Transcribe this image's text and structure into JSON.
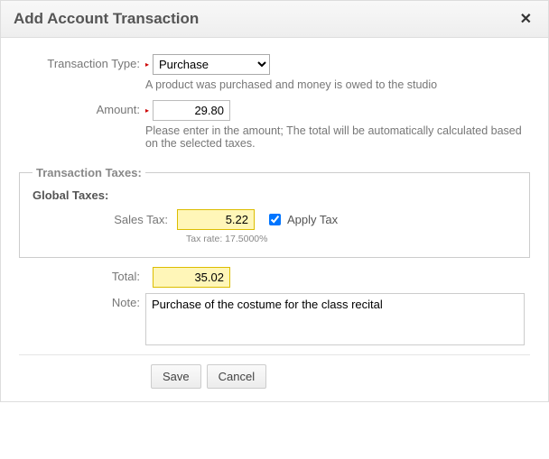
{
  "dialog": {
    "title": "Add Account Transaction"
  },
  "labels": {
    "transactionType": "Transaction Type:",
    "amount": "Amount:",
    "total": "Total:",
    "note": "Note:",
    "salesTax": "Sales Tax:",
    "applyTax": "Apply Tax",
    "globalTaxes": "Global Taxes:",
    "taxesLegend": "Transaction Taxes:"
  },
  "transaction": {
    "typeOptions": [
      "Purchase"
    ],
    "typeSelected": "Purchase",
    "typeHelp": "A product was purchased and money is owed to the studio",
    "amount": "29.80",
    "amountHelp": "Please enter in the amount; The total will be automatically calculated based on the selected taxes.",
    "total": "35.02",
    "note": "Purchase of the costume for the class recital"
  },
  "taxes": {
    "salesTaxAmount": "5.22",
    "applyTaxChecked": true,
    "rateText": "Tax rate: 17.5000%"
  },
  "buttons": {
    "save": "Save",
    "cancel": "Cancel"
  }
}
